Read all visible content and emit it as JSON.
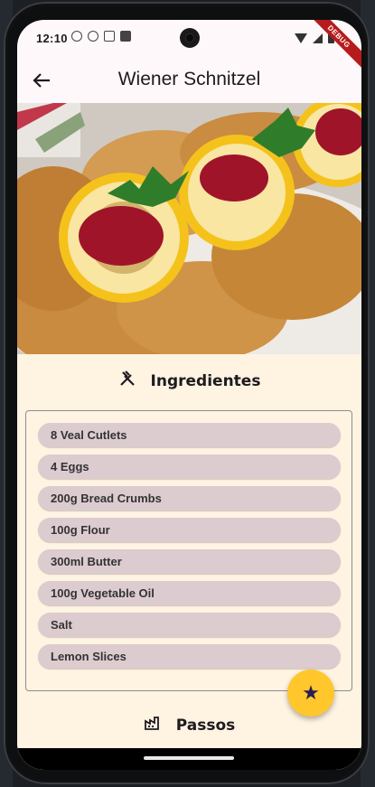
{
  "status_bar": {
    "time": "12:10",
    "debug_banner": "DEBUG"
  },
  "app_bar": {
    "title": "Wiener Schnitzel",
    "back_icon": "arrow-back-icon"
  },
  "ingredients": {
    "heading": "Ingredientes",
    "icon": "utensils-icon",
    "items": [
      "8 Veal Cutlets",
      "4 Eggs",
      "200g Bread Crumbs",
      "100g Flour",
      "300ml Butter",
      "100g Vegetable Oil",
      "Salt",
      "Lemon Slices"
    ]
  },
  "steps": {
    "heading": "Passos",
    "icon": "factory-icon"
  },
  "fab": {
    "icon": "star-icon"
  },
  "colors": {
    "accent": "#ffc72c",
    "chip": "#dccbcf",
    "content_bg": "#fff3e2"
  }
}
